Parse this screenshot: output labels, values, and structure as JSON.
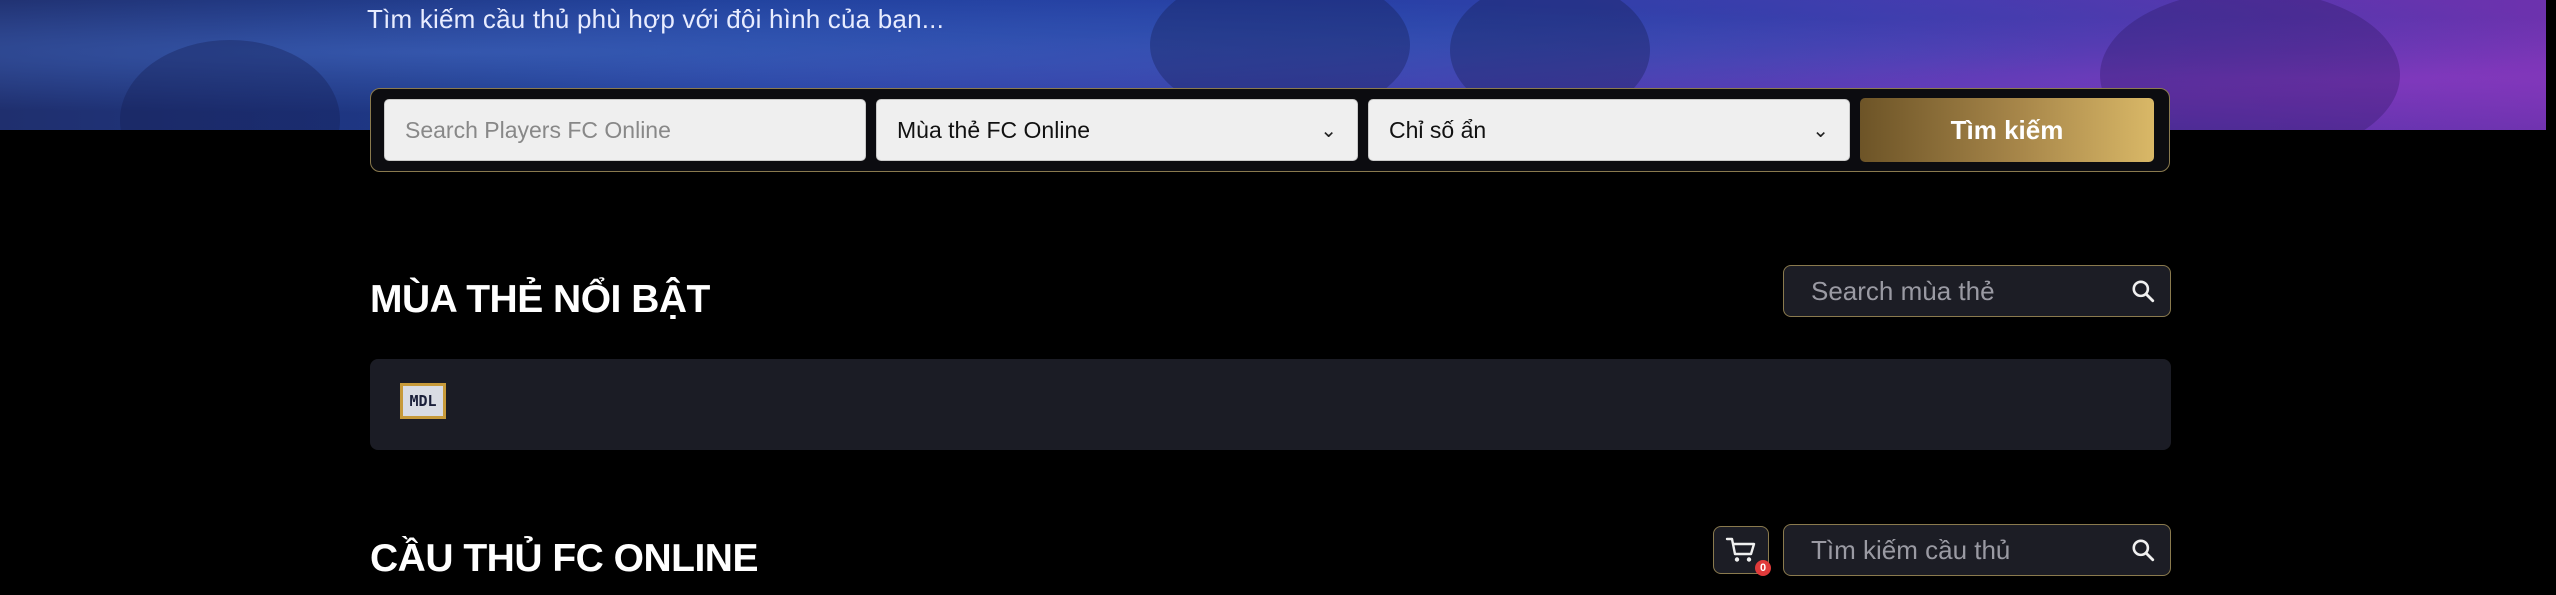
{
  "hero": {
    "subtitle": "Tìm kiếm cầu thủ phù hợp với đội hình của bạn..."
  },
  "search": {
    "player_placeholder": "Search Players FC Online",
    "season_select": "Mùa thẻ FC Online",
    "stat_select": "Chỉ số ẩn",
    "submit_label": "Tìm kiếm"
  },
  "featured_seasons": {
    "title": "MÙA THẺ NỔI BẬT",
    "search_placeholder": "Search mùa thẻ",
    "items": [
      {
        "label": "MDL"
      }
    ]
  },
  "players": {
    "title": "CẦU THỦ FC ONLINE",
    "search_placeholder": "Tìm kiếm cầu thủ",
    "cart_count": "0"
  },
  "colors": {
    "accent_gold": "#c9a452",
    "panel": "#1b1c25",
    "background": "#000000"
  },
  "icons": [
    "search-icon",
    "cart-icon",
    "chevron-down-icon"
  ]
}
